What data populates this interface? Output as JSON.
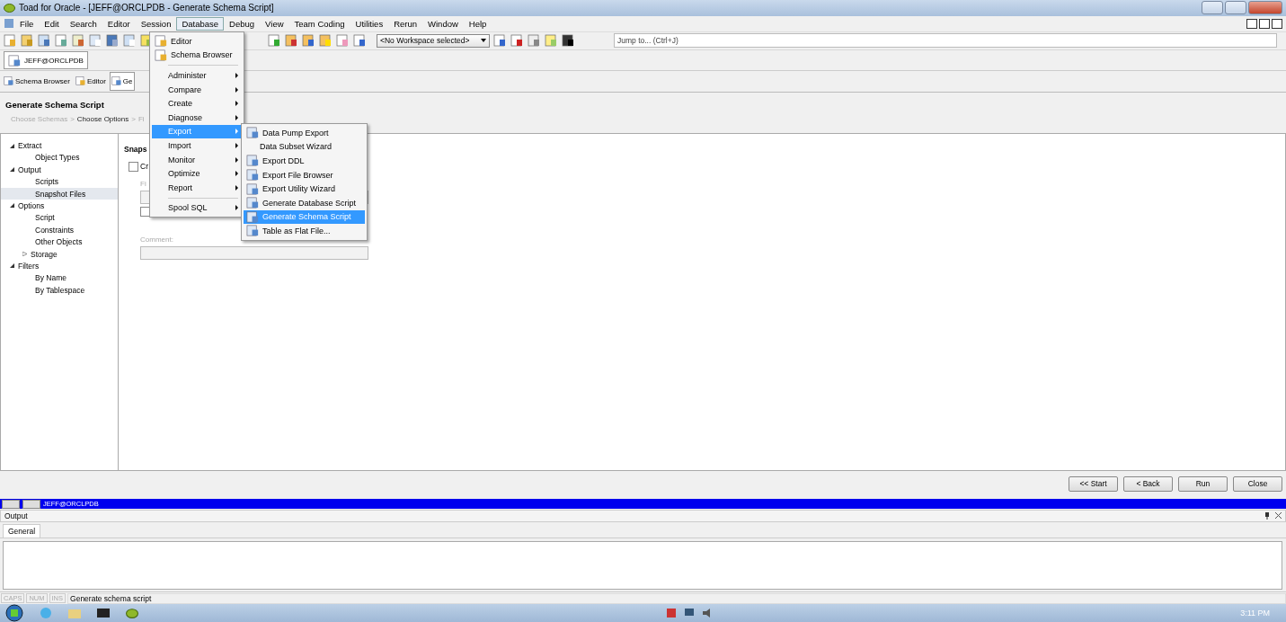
{
  "title_bar": {
    "title": "Toad for Oracle - [JEFF@ORCLPDB - Generate Schema Script]"
  },
  "menu_bar": [
    {
      "label": "File",
      "selected": false
    },
    {
      "label": "Edit",
      "selected": false
    },
    {
      "label": "Search",
      "selected": false
    },
    {
      "label": "Editor",
      "selected": false
    },
    {
      "label": "Session",
      "selected": false
    },
    {
      "label": "Database",
      "selected": true
    },
    {
      "label": "Debug",
      "selected": false
    },
    {
      "label": "View",
      "selected": false
    },
    {
      "label": "Team Coding",
      "selected": false
    },
    {
      "label": "Utilities",
      "selected": false
    },
    {
      "label": "Rerun",
      "selected": false
    },
    {
      "label": "Window",
      "selected": false
    },
    {
      "label": "Help",
      "selected": false
    }
  ],
  "toolbar": {
    "workspace_dropdown": "<No Workspace selected>",
    "jump_field": {
      "placeholder": "Jump to... (Ctrl+J)"
    }
  },
  "connection_tab": "JEFF@ORCLPDB",
  "window_tabs": [
    {
      "label": "Schema Browser",
      "selected": false
    },
    {
      "label": "Editor",
      "selected": false
    },
    {
      "label": "Ge",
      "selected": true
    }
  ],
  "wizard": {
    "title": "Generate Schema Script",
    "separator": ">",
    "steps": [
      {
        "label": "Choose Schemas",
        "current": false
      },
      {
        "label": "Choose Options",
        "current": true
      },
      {
        "label": "Fi",
        "current": false
      }
    ]
  },
  "tree": [
    {
      "label": "Extract",
      "expanded": true,
      "selected": false,
      "children": [
        {
          "label": "Object Types",
          "selected": false
        }
      ]
    },
    {
      "label": "Output",
      "expanded": true,
      "selected": false,
      "children": [
        {
          "label": "Scripts",
          "selected": false
        },
        {
          "label": "Snapshot Files",
          "selected": true
        }
      ]
    },
    {
      "label": "Options",
      "expanded": true,
      "selected": false,
      "children": [
        {
          "label": "Script",
          "selected": false
        },
        {
          "label": "Constraints",
          "selected": false
        },
        {
          "label": "Other Objects",
          "selected": false
        },
        {
          "label": "Storage",
          "selected": false,
          "expanded": false
        }
      ]
    },
    {
      "label": "Filters",
      "expanded": true,
      "selected": false,
      "children": [
        {
          "label": "By Name",
          "selected": false
        },
        {
          "label": "By Tablespace",
          "selected": false
        }
      ]
    }
  ],
  "content": {
    "heading": "Snaps",
    "create_checkbox": {
      "label": "Cr",
      "checked": false
    },
    "file_label": "Fi",
    "second_checkbox": {
      "checked": false
    },
    "comment_label": "Comment:"
  },
  "buttons": [
    "<< Start",
    "< Back",
    "Run",
    "Close"
  ],
  "connection_bar": "JEFF@ORCLPDB",
  "output": {
    "title": "Output",
    "tabs": [
      {
        "label": "General",
        "selected": true
      }
    ]
  },
  "status_bar": {
    "indicators": [
      {
        "label": "CAPS",
        "on": false
      },
      {
        "label": "NUM",
        "on": false
      },
      {
        "label": "INS",
        "on": false
      }
    ],
    "message": "Generate schema script"
  },
  "taskbar": {
    "clock": "3:11 PM"
  },
  "database_menu": [
    {
      "kind": "item",
      "label": "Editor",
      "icon": true,
      "submenu": false,
      "selected": false
    },
    {
      "kind": "item",
      "label": "Schema Browser",
      "icon": true,
      "submenu": false,
      "selected": false
    },
    {
      "kind": "separator"
    },
    {
      "kind": "item",
      "label": "Administer",
      "icon": false,
      "submenu": true,
      "selected": false
    },
    {
      "kind": "item",
      "label": "Compare",
      "icon": false,
      "submenu": true,
      "selected": false
    },
    {
      "kind": "item",
      "label": "Create",
      "icon": false,
      "submenu": true,
      "selected": false
    },
    {
      "kind": "item",
      "label": "Diagnose",
      "icon": false,
      "submenu": true,
      "selected": false
    },
    {
      "kind": "item",
      "label": "Export",
      "icon": false,
      "submenu": true,
      "selected": true
    },
    {
      "kind": "item",
      "label": "Import",
      "icon": false,
      "submenu": true,
      "selected": false
    },
    {
      "kind": "item",
      "label": "Monitor",
      "icon": false,
      "submenu": true,
      "selected": false
    },
    {
      "kind": "item",
      "label": "Optimize",
      "icon": false,
      "submenu": true,
      "selected": false
    },
    {
      "kind": "item",
      "label": "Report",
      "icon": false,
      "submenu": true,
      "selected": false
    },
    {
      "kind": "separator"
    },
    {
      "kind": "item",
      "label": "Spool SQL",
      "icon": false,
      "submenu": true,
      "selected": false
    }
  ],
  "export_submenu": [
    {
      "label": "Data Pump Export",
      "icon": true,
      "selected": false
    },
    {
      "label": "Data Subset Wizard",
      "icon": false,
      "selected": false
    },
    {
      "label": "Export DDL",
      "icon": true,
      "selected": false
    },
    {
      "label": "Export File Browser",
      "icon": true,
      "selected": false
    },
    {
      "label": "Export Utility Wizard",
      "icon": true,
      "selected": false
    },
    {
      "label": "Generate Database Script",
      "icon": true,
      "selected": false
    },
    {
      "label": "Generate Schema Script",
      "icon": true,
      "selected": true
    },
    {
      "label": "Table as Flat File...",
      "icon": true,
      "selected": false
    }
  ]
}
